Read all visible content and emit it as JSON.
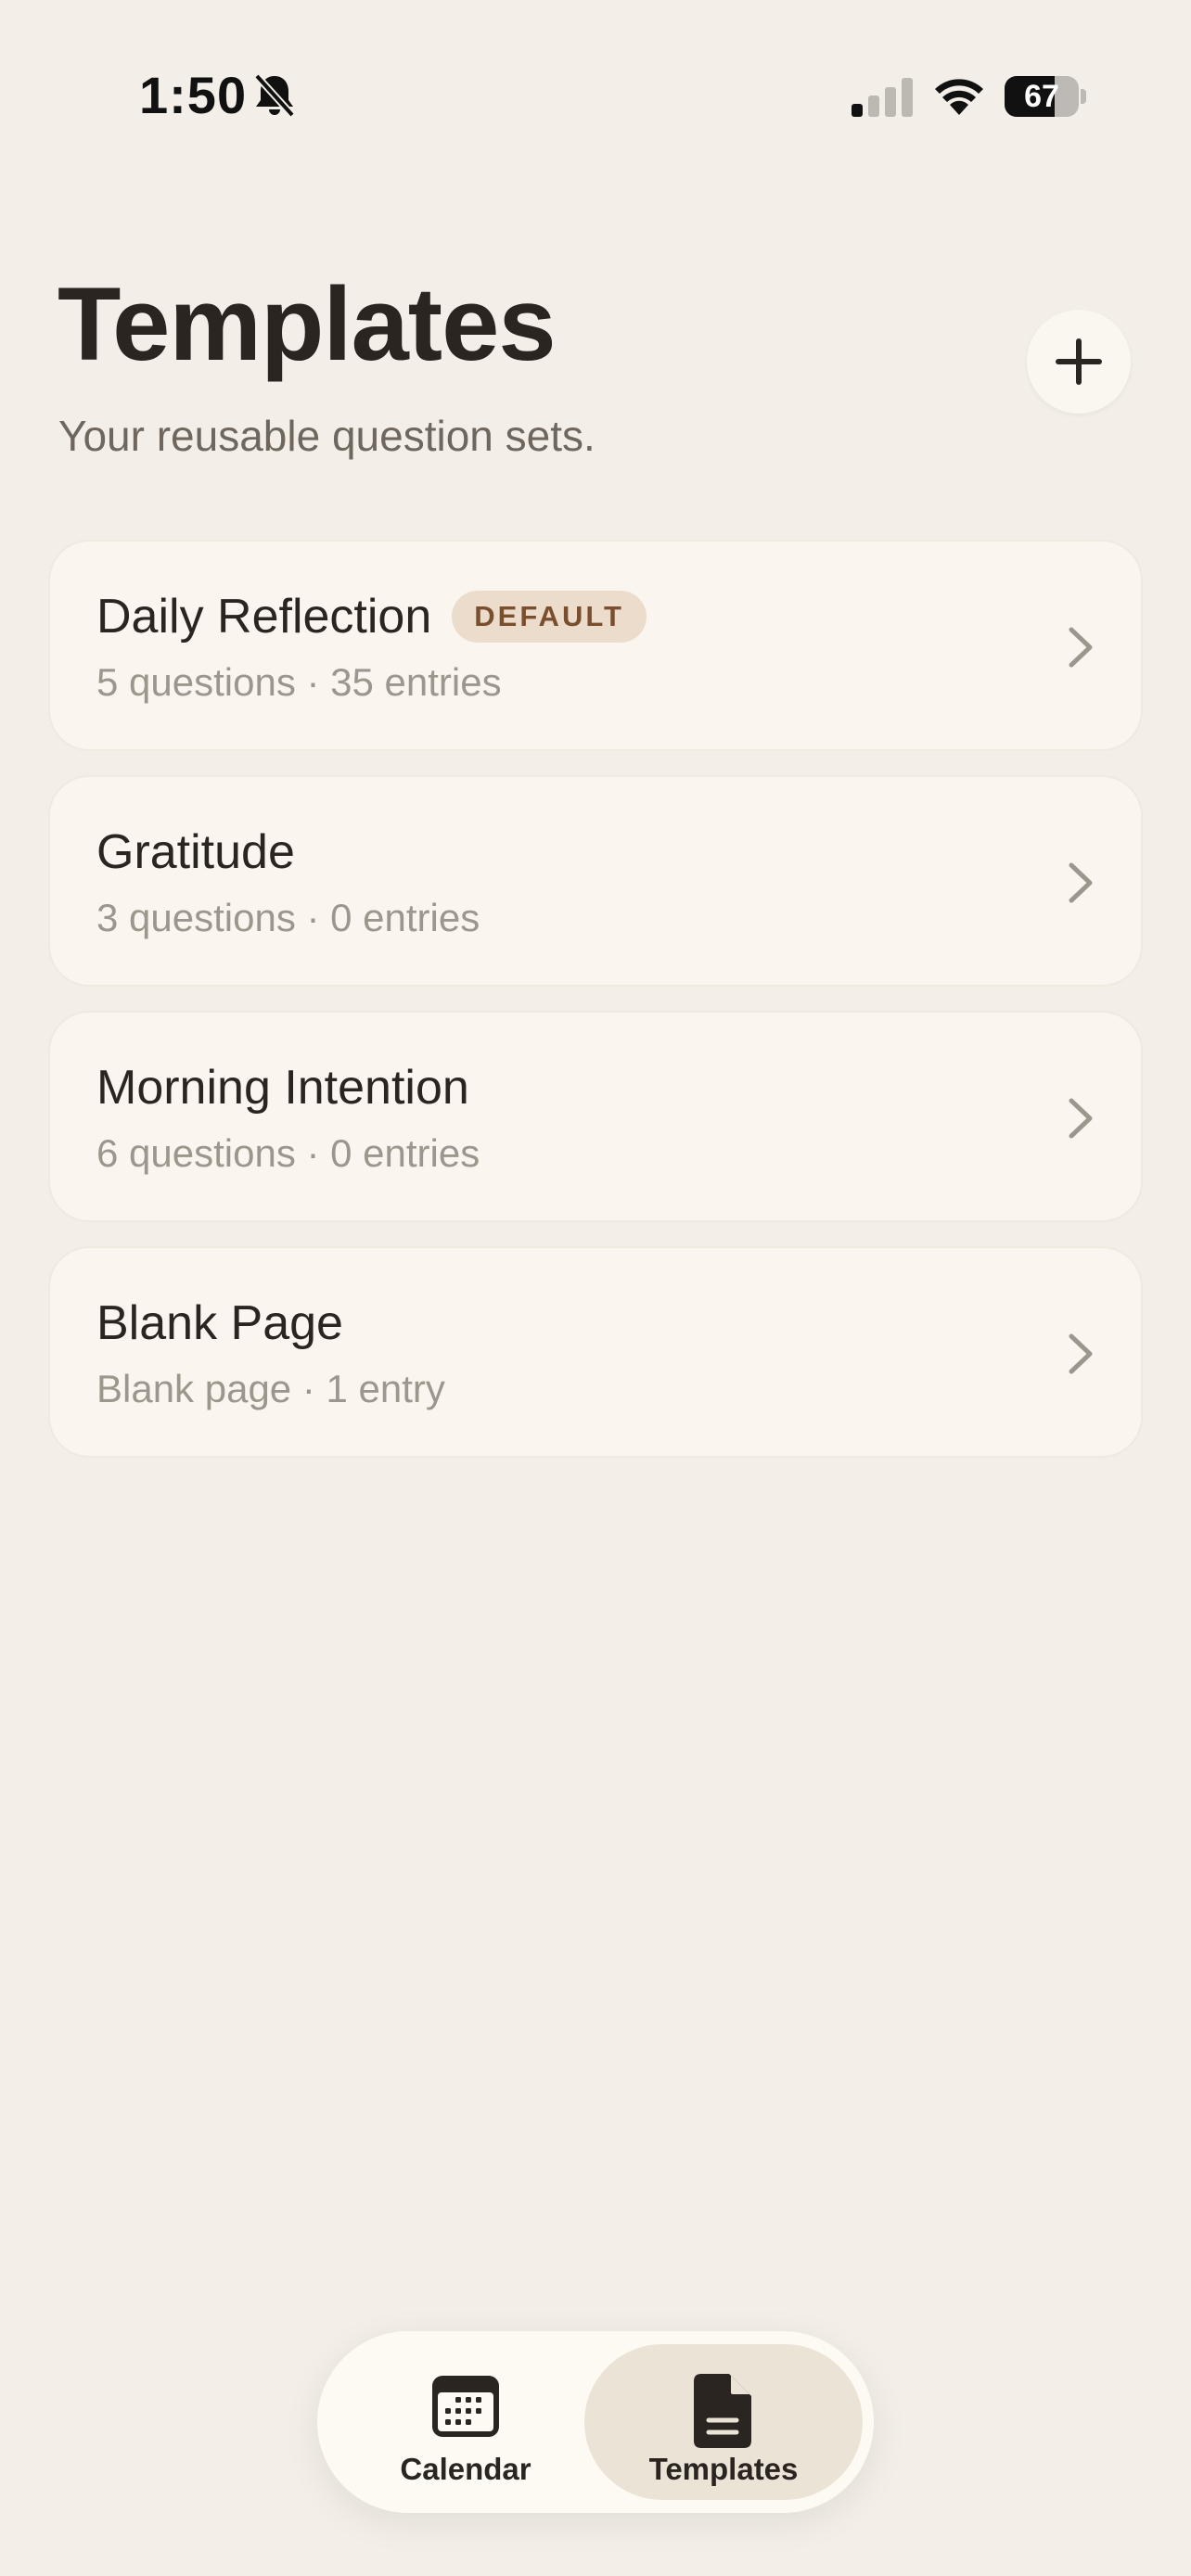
{
  "status_bar": {
    "time": "1:50",
    "battery_level": 67,
    "icons": [
      "bell-slash-icon",
      "cellular-signal-icon",
      "wifi-icon",
      "battery-icon"
    ]
  },
  "header": {
    "title": "Templates",
    "subtitle": "Your reusable question sets.",
    "add_icon": "plus-icon"
  },
  "templates": [
    {
      "name": "Daily Reflection",
      "badge": "DEFAULT",
      "meta": "5 questions · 35 entries"
    },
    {
      "name": "Gratitude",
      "meta": "3 questions · 0 entries"
    },
    {
      "name": "Morning Intention",
      "meta": "6 questions · 0 entries"
    },
    {
      "name": "Blank Page",
      "meta": "Blank page · 1 entry"
    }
  ],
  "tab_bar": {
    "tabs": [
      {
        "label": "Calendar",
        "icon": "calendar-icon",
        "selected": false
      },
      {
        "label": "Templates",
        "icon": "document-icon",
        "selected": true
      }
    ]
  },
  "colors": {
    "background": "#f3efe8",
    "card": "#faf6ef",
    "badge_bg": "#ecdccb",
    "badge_text": "#7a4f2e",
    "selected_tab": "#ece3d7"
  }
}
